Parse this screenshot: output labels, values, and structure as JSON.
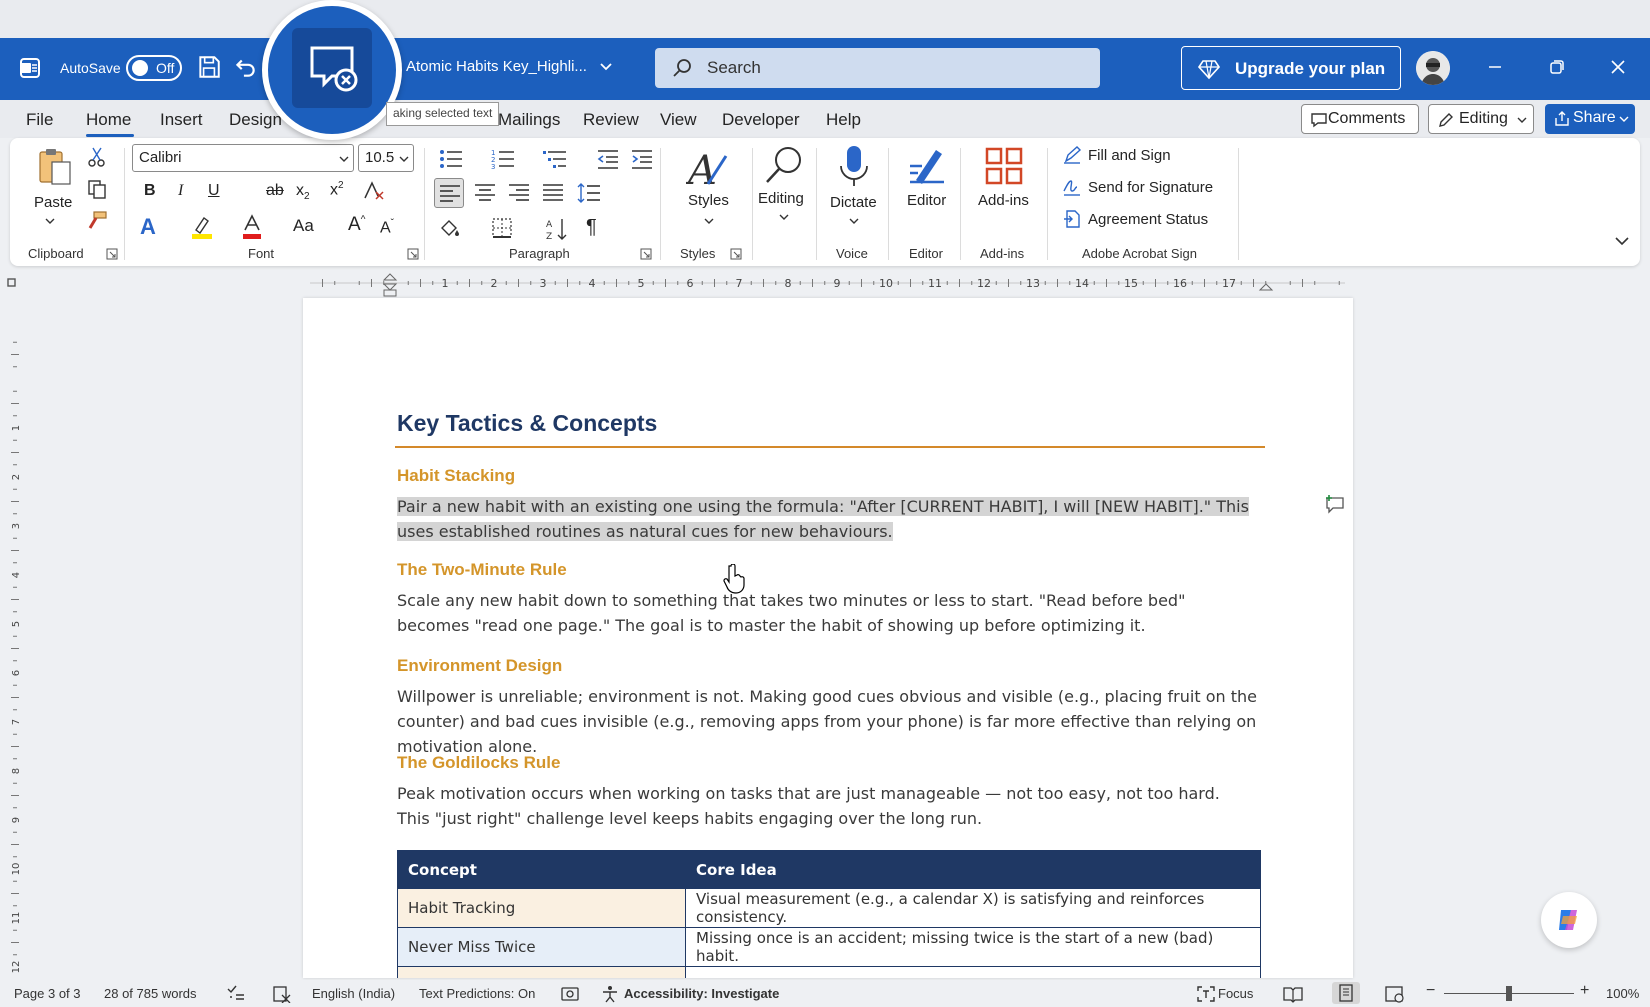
{
  "titlebar": {
    "autosave_label": "AutoSave",
    "autosave_state": "Off",
    "doc_title": "Atomic Habits Key_Highli...",
    "search_placeholder": "Search",
    "upgrade_label": "Upgrade your plan"
  },
  "tooltip": "aking selected text",
  "menu": {
    "tabs": [
      "File",
      "Home",
      "Insert",
      "Design",
      "Mailings",
      "Review",
      "View",
      "Developer",
      "Help"
    ],
    "active": "Home",
    "comments_label": "Comments",
    "editing_label": "Editing",
    "share_label": "Share"
  },
  "ribbon": {
    "clipboard": {
      "paste_label": "Paste",
      "group_label": "Clipboard"
    },
    "font": {
      "font_name": "Calibri",
      "font_size": "10.5",
      "group_label": "Font"
    },
    "paragraph": {
      "group_label": "Paragraph"
    },
    "styles": {
      "styles_label": "Styles",
      "group_label": "Styles"
    },
    "editing": {
      "label": "Editing"
    },
    "voice": {
      "dictate_label": "Dictate",
      "group_label": "Voice"
    },
    "editor": {
      "label": "Editor",
      "group_label": "Editor"
    },
    "addins": {
      "label": "Add-ins",
      "group_label": "Add-ins"
    },
    "acrobat": {
      "items": [
        "Fill and Sign",
        "Send for Signature",
        "Agreement Status"
      ],
      "group_label": "Adobe Acrobat Sign"
    }
  },
  "ruler": {
    "ticks": [
      "1",
      "2",
      "3",
      "4",
      "5",
      "6",
      "7",
      "8",
      "9",
      "10",
      "11",
      "12",
      "13",
      "14",
      "15",
      "16",
      "17"
    ]
  },
  "vruler": {
    "ticks": [
      "1",
      "2",
      "3",
      "4",
      "5",
      "6",
      "7",
      "8",
      "9",
      "10",
      "11",
      "12"
    ]
  },
  "document": {
    "heading": "Key Tactics & Concepts",
    "sections": [
      {
        "title": "Habit Stacking",
        "body": "Pair a new habit with an existing one using the formula: \"After [CURRENT HABIT], I will [NEW HABIT].\" This uses established routines as natural cues for new behaviours."
      },
      {
        "title": "The Two-Minute Rule",
        "body": "Scale any new habit down to something that takes two minutes or less to start. \"Read before bed\" becomes \"read one page.\" The goal is to master the habit of showing up before optimizing it."
      },
      {
        "title": "Environment Design",
        "body": "Willpower is unreliable; environment is not. Making good cues obvious and visible (e.g., placing fruit on the counter) and bad cues invisible (e.g., removing apps from your phone) is far more effective than relying on motivation alone."
      },
      {
        "title": "The Goldilocks Rule",
        "body": "Peak motivation occurs when working on tasks that are just manageable — not too easy, not too hard. This \"just right\" challenge level keeps habits engaging over the long run."
      }
    ],
    "table": {
      "headers": [
        "Concept",
        "Core Idea"
      ],
      "rows": [
        [
          "Habit Tracking",
          "Visual measurement (e.g., a calendar X) is satisfying and reinforces consistency."
        ],
        [
          "Never Miss Twice",
          "Missing once is an accident; missing twice is the start of a new (bad) habit."
        ],
        [
          "",
          ""
        ]
      ]
    }
  },
  "statusbar": {
    "page": "Page 3 of 3",
    "words": "28 of 785 words",
    "language": "English (India)",
    "predictions": "Text Predictions: On",
    "accessibility": "Accessibility: Investigate",
    "focus": "Focus",
    "zoom": "100%"
  },
  "colors": {
    "titlebar": "#1c5fbd",
    "heading": "#1f3864",
    "section_title": "#d4952a",
    "rule": "#d4892a",
    "highlight": "#d4d4d4"
  }
}
